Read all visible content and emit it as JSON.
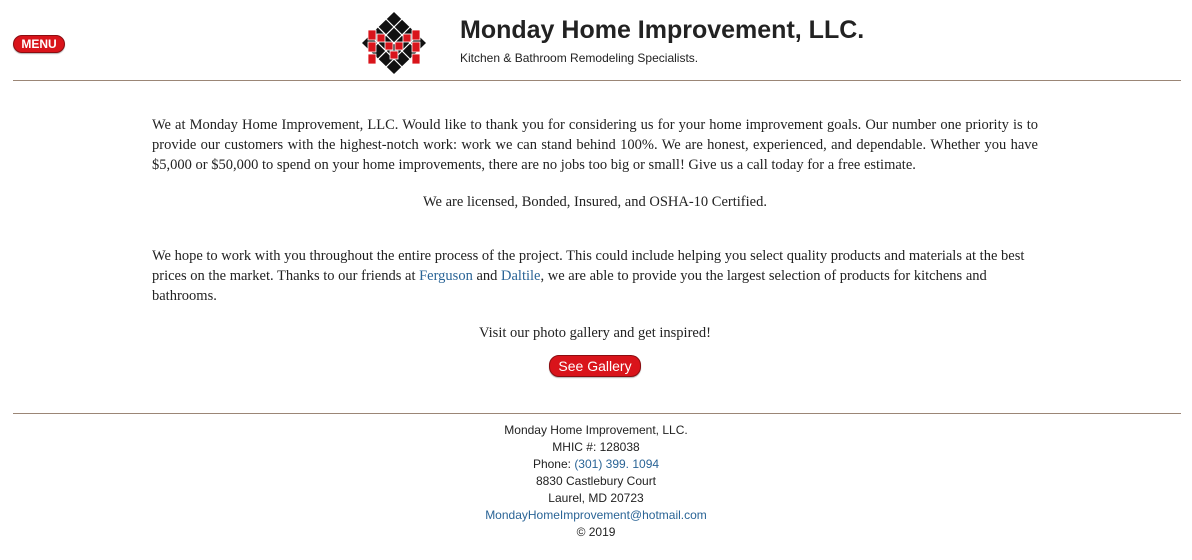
{
  "menu": {
    "label": "MENU"
  },
  "brand": {
    "title": "Monday Home Improvement, LLC.",
    "subtitle": "Kitchen & Bathroom Remodeling Specialists."
  },
  "main": {
    "intro": "We at Monday Home Improvement, LLC. Would like to thank you for considering us for your home improvement goals. Our number one priority is to provide our customers with the highest-notch work: work we can stand behind 100%. We are honest, experienced, and dependable. Whether you have $5,000 or $50,000 to spend on your home improvements, there are no jobs too big or small! Give us a call today for a free estimate.",
    "licensed": "We are licensed, Bonded, Insured, and OSHA-10 Certified.",
    "partners_before": "We hope to work with you throughout the entire process of the project. This could include helping you select quality products and materials at the best prices on the market. Thanks to our friends at ",
    "ferguson": "Ferguson",
    "and": " and ",
    "daltile": "Daltile",
    "partners_after": ", we are able to provide you the largest selection of products for kitchens and bathrooms.",
    "gallery_prompt": "Visit our photo gallery and get inspired!",
    "gallery_button": "See Gallery"
  },
  "footer": {
    "company": "Monday Home Improvement, LLC.",
    "mhic": "MHIC #: 128038",
    "phone_label": "Phone: ",
    "phone": "(301) 399. 1094",
    "street": "8830 Castlebury Court",
    "city": "Laurel, MD 20723",
    "email": "MondayHomeImprovement@hotmail.com",
    "copyright": "© 2019"
  },
  "colors": {
    "accent": "#d9141b",
    "link": "#2a6496",
    "rule": "#9b8676"
  }
}
